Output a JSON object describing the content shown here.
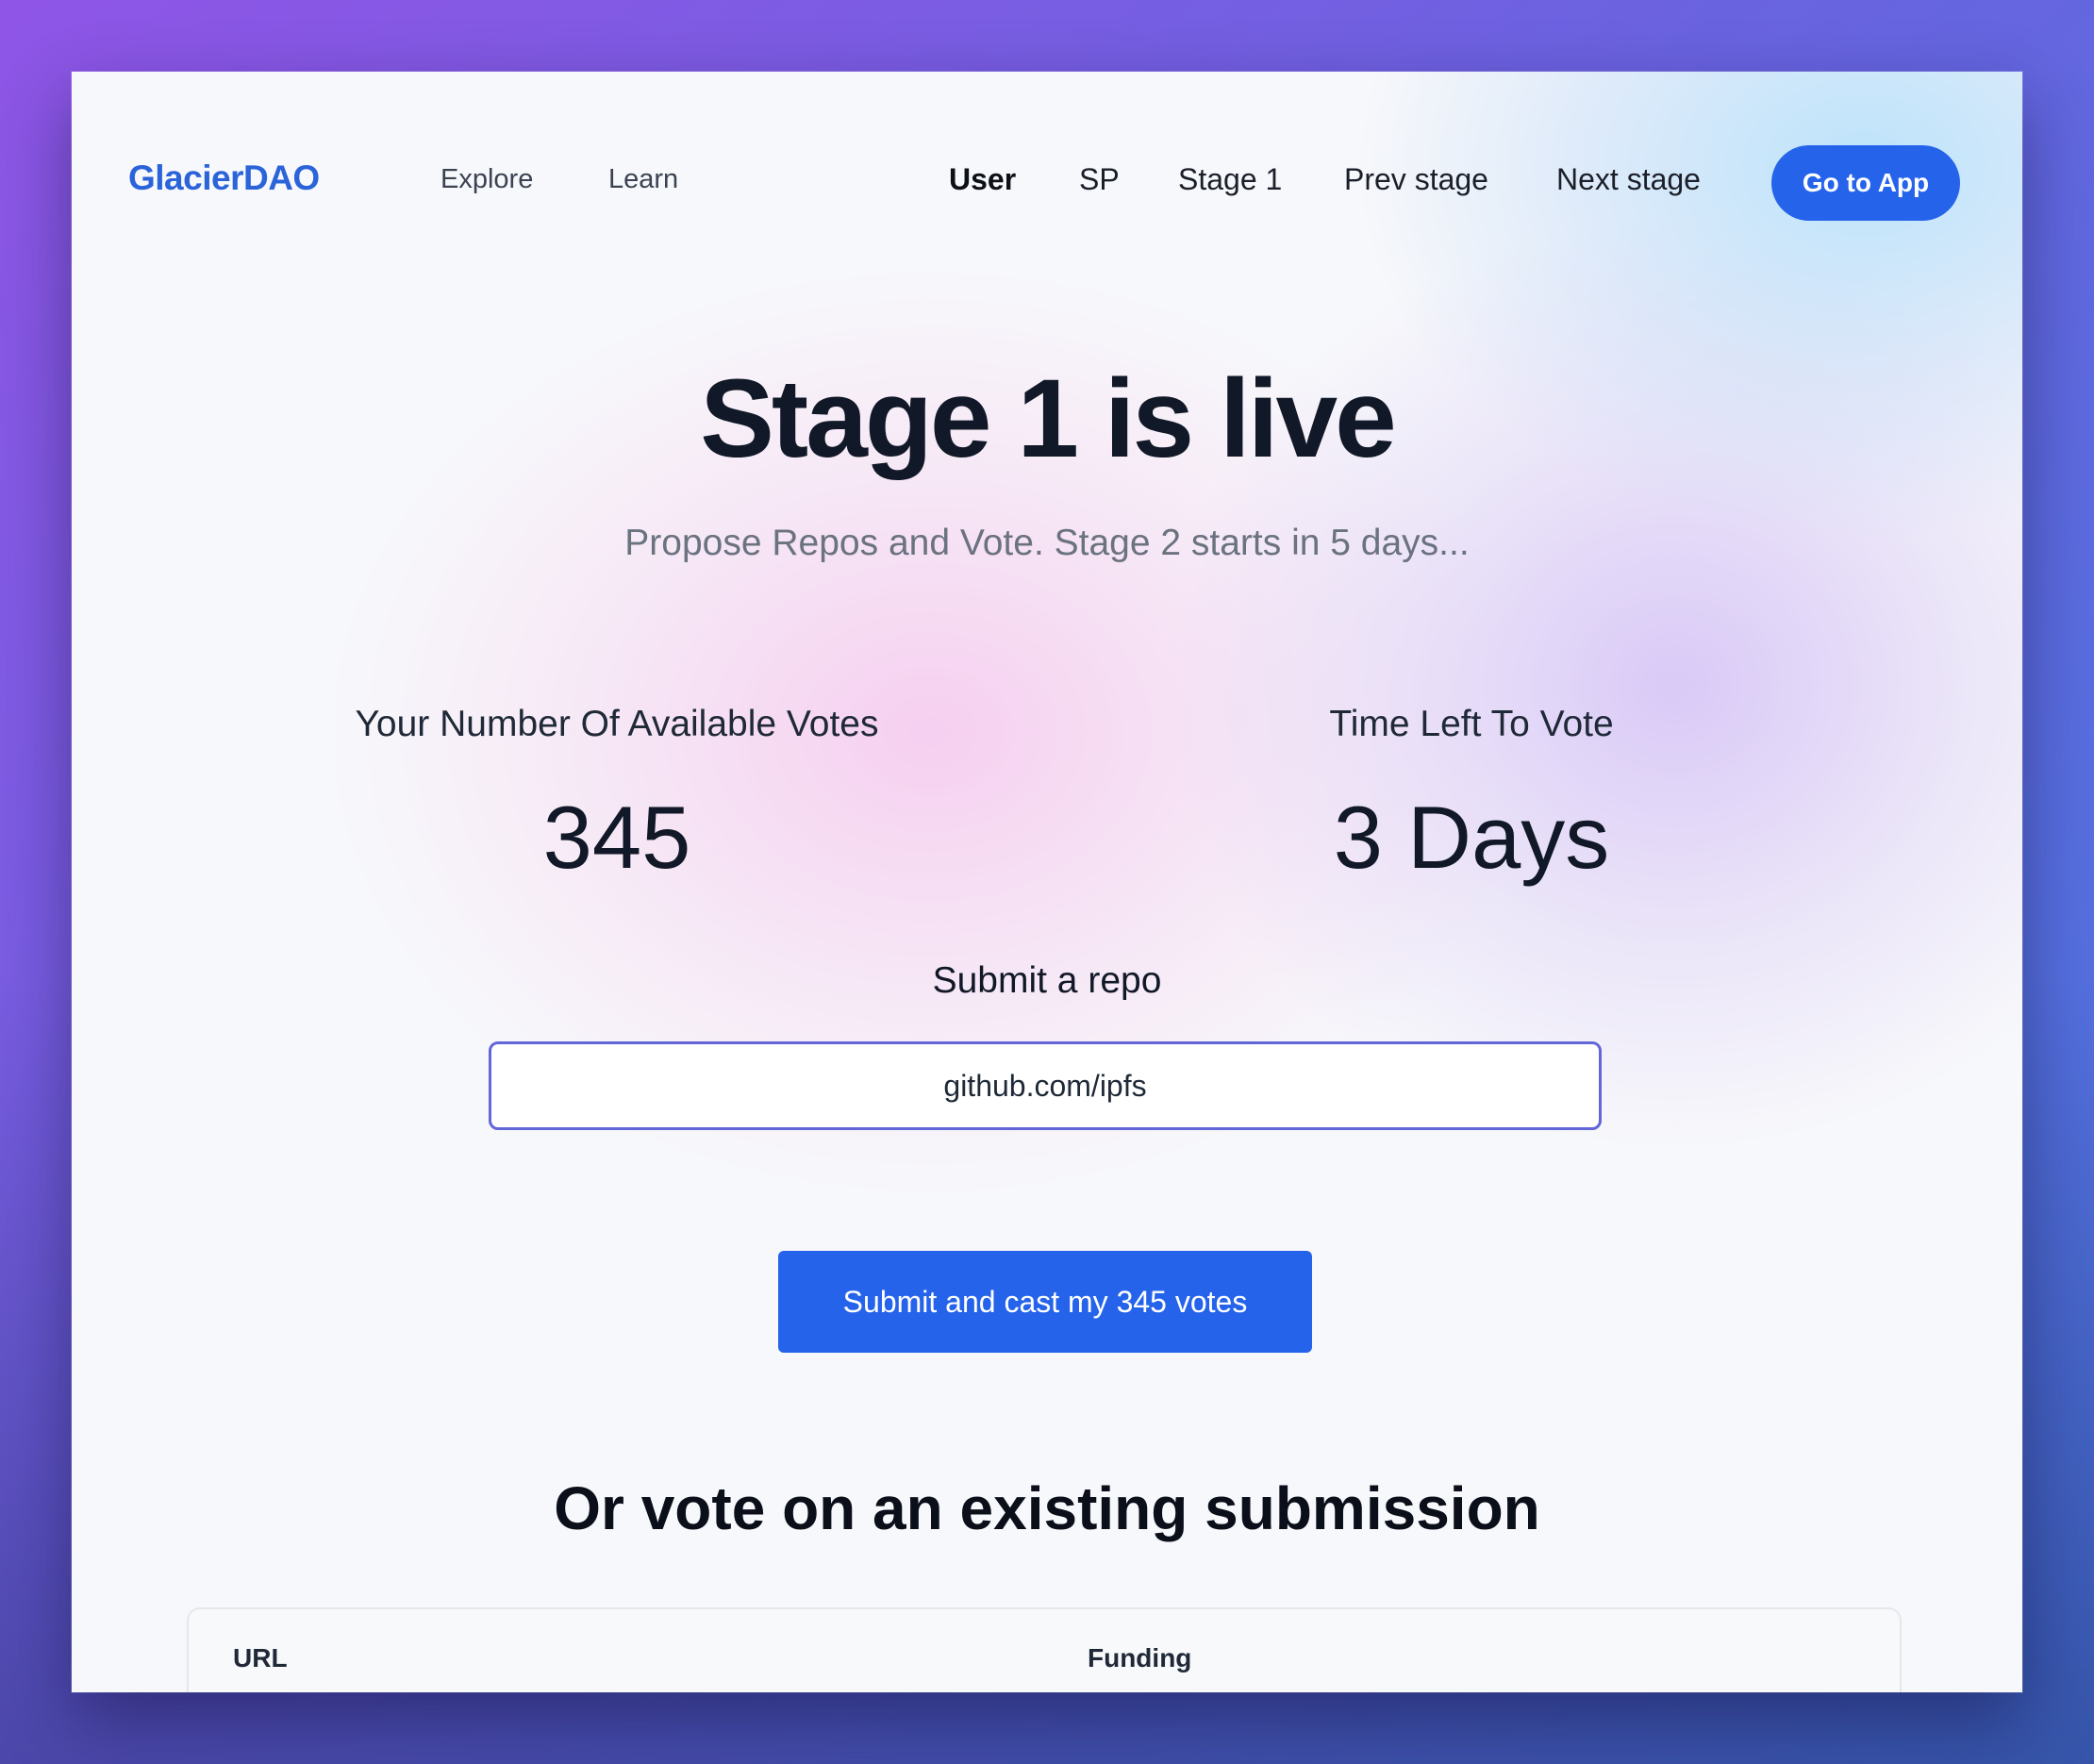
{
  "brand": {
    "logo_text": "GlacierDAO",
    "accent_color": "#2563eb",
    "logo_color": "#2b63d9"
  },
  "nav": {
    "left_links": [
      "Explore",
      "Learn"
    ],
    "right_links": [
      "User",
      "SP",
      "Stage 1",
      "Prev stage",
      "Next stage"
    ],
    "active_link": "User",
    "cta_label": "Go to App"
  },
  "hero": {
    "title": "Stage 1 is live",
    "subtitle": "Propose Repos and Vote. Stage 2 starts in 5 days..."
  },
  "stats": {
    "votes_label": "Your Number Of Available Votes",
    "votes_value": "345",
    "time_label": "Time Left To Vote",
    "time_value": "3 Days"
  },
  "submit": {
    "label": "Submit a repo",
    "input_value": "github.com/ipfs",
    "button_label": "Submit and cast my 345 votes"
  },
  "existing": {
    "heading": "Or vote on an existing submission",
    "columns": [
      "URL",
      "Funding"
    ]
  }
}
